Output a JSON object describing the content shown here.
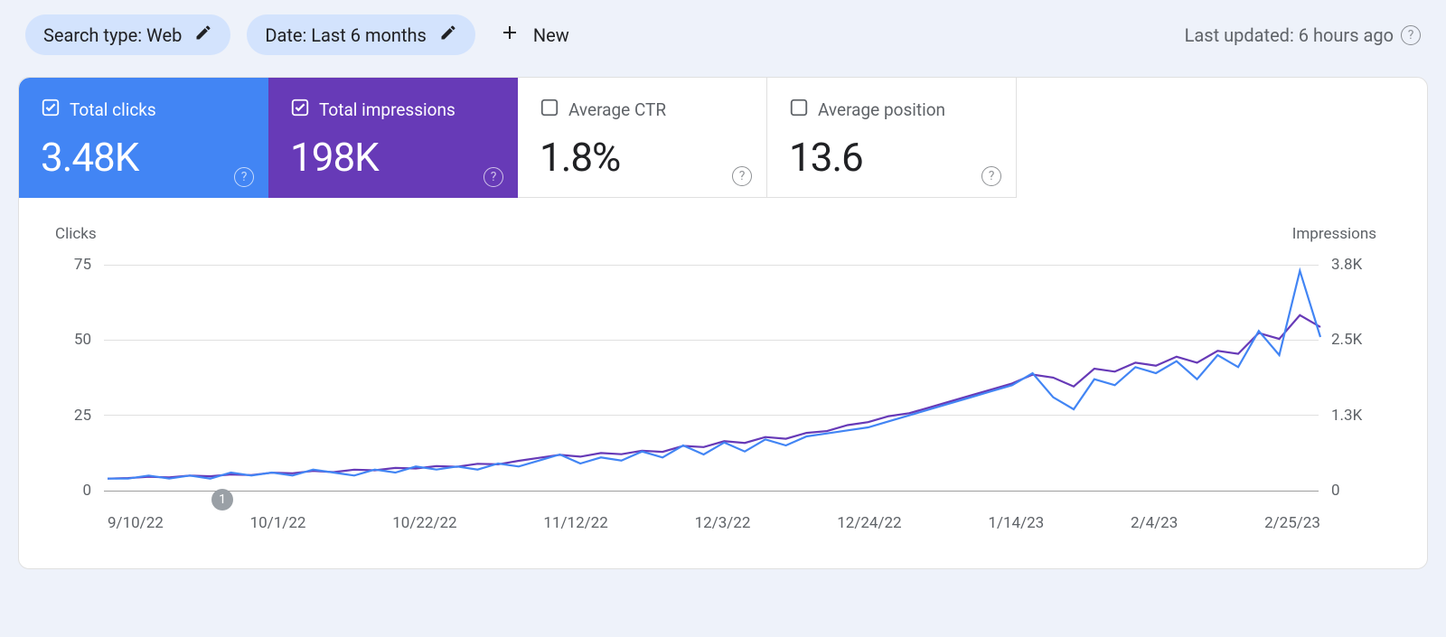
{
  "filters": {
    "search_type": "Search type: Web",
    "date_range": "Date: Last 6 months",
    "new_label": "New"
  },
  "status": {
    "last_updated": "Last updated: 6 hours ago"
  },
  "metrics": {
    "clicks": {
      "label": "Total clicks",
      "value": "3.48K",
      "checked": true,
      "color": "blue"
    },
    "impressions": {
      "label": "Total impressions",
      "value": "198K",
      "checked": true,
      "color": "purple"
    },
    "ctr": {
      "label": "Average CTR",
      "value": "1.8%",
      "checked": false,
      "color": "white"
    },
    "position": {
      "label": "Average position",
      "value": "13.6",
      "checked": false,
      "color": "white"
    }
  },
  "chart": {
    "left_axis_title": "Clicks",
    "right_axis_title": "Impressions",
    "left_ticks": [
      "75",
      "50",
      "25",
      "0"
    ],
    "right_ticks": [
      "3.8K",
      "2.5K",
      "1.3K",
      "0"
    ],
    "x_ticks": [
      "9/10/22",
      "10/1/22",
      "10/22/22",
      "11/12/22",
      "12/3/22",
      "12/24/22",
      "1/14/23",
      "2/4/23",
      "2/25/23"
    ],
    "marker_label": "1"
  },
  "chart_data": {
    "type": "line",
    "title": "",
    "x": [
      "9/10/22",
      "9/13/22",
      "9/16/22",
      "9/19/22",
      "9/22/22",
      "9/25/22",
      "9/28/22",
      "10/1/22",
      "10/4/22",
      "10/7/22",
      "10/10/22",
      "10/13/22",
      "10/16/22",
      "10/19/22",
      "10/22/22",
      "10/25/22",
      "10/28/22",
      "10/31/22",
      "11/3/22",
      "11/6/22",
      "11/9/22",
      "11/12/22",
      "11/15/22",
      "11/18/22",
      "11/21/22",
      "11/24/22",
      "11/27/22",
      "11/30/22",
      "12/3/22",
      "12/6/22",
      "12/9/22",
      "12/12/22",
      "12/15/22",
      "12/18/22",
      "12/21/22",
      "12/24/22",
      "12/27/22",
      "12/30/22",
      "1/2/23",
      "1/5/23",
      "1/8/23",
      "1/11/23",
      "1/14/23",
      "1/17/23",
      "1/20/23",
      "1/23/23",
      "1/26/23",
      "1/29/23",
      "2/1/23",
      "2/4/23",
      "2/7/23",
      "2/10/23",
      "2/13/23",
      "2/16/23",
      "2/19/23",
      "2/22/23",
      "2/25/23",
      "2/28/23",
      "3/3/23",
      "3/6/23"
    ],
    "series": [
      {
        "name": "Clicks",
        "yaxis": "left",
        "ylim": [
          0,
          75
        ],
        "values": [
          1,
          1,
          2,
          1,
          2,
          1,
          3,
          2,
          3,
          2,
          4,
          3,
          2,
          4,
          3,
          5,
          4,
          5,
          4,
          6,
          5,
          7,
          9,
          6,
          8,
          7,
          10,
          8,
          12,
          9,
          13,
          10,
          14,
          12,
          15,
          16,
          17,
          18,
          20,
          22,
          24,
          26,
          28,
          30,
          32,
          36,
          28,
          24,
          34,
          32,
          38,
          36,
          40,
          34,
          42,
          38,
          50,
          42,
          70,
          48
        ]
      },
      {
        "name": "Impressions",
        "yaxis": "right",
        "ylim": [
          0,
          3800
        ],
        "values": [
          50,
          60,
          80,
          70,
          100,
          90,
          120,
          110,
          150,
          140,
          180,
          160,
          200,
          190,
          230,
          220,
          260,
          250,
          300,
          290,
          350,
          400,
          450,
          420,
          480,
          460,
          520,
          500,
          600,
          580,
          680,
          650,
          750,
          720,
          820,
          850,
          950,
          1000,
          1100,
          1150,
          1250,
          1350,
          1450,
          1550,
          1650,
          1800,
          1750,
          1600,
          1900,
          1850,
          2000,
          1950,
          2100,
          2000,
          2200,
          2150,
          2500,
          2400,
          2800,
          2600
        ]
      }
    ],
    "x_tick_labels": [
      "9/10/22",
      "10/1/22",
      "10/22/22",
      "11/12/22",
      "12/3/22",
      "12/24/22",
      "1/14/23",
      "2/4/23",
      "2/25/23"
    ],
    "left_ylabel": "Clicks",
    "right_ylabel": "Impressions"
  }
}
